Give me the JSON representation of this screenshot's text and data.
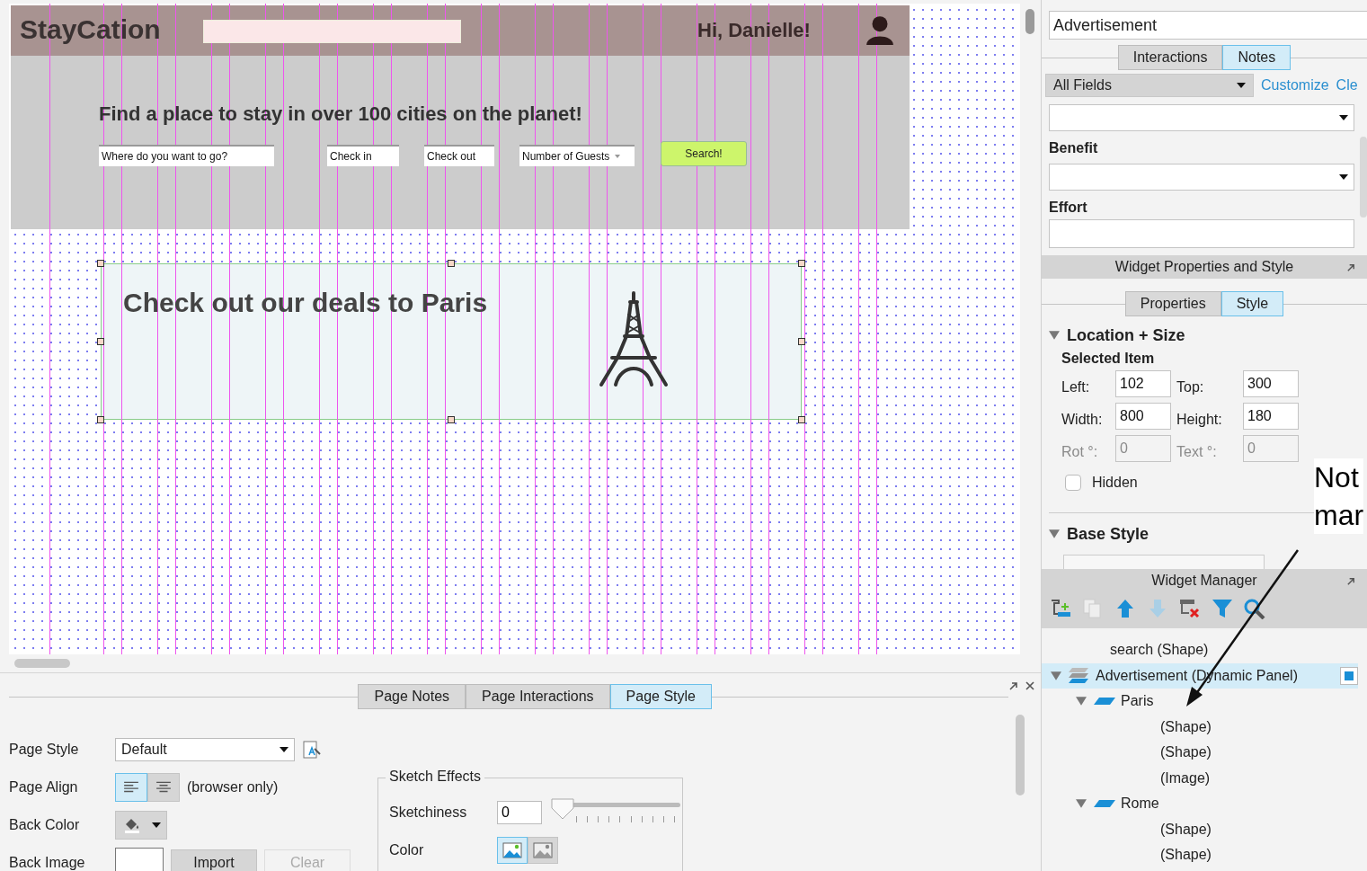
{
  "canvas": {
    "header": {
      "logo": "StayCation",
      "greeting": "Hi, Danielle!"
    },
    "hero": {
      "headline": "Find a place to stay in over 100 cities on the planet!",
      "fields": [
        {
          "kind": "text",
          "placeholder": "Where do you want to go?"
        },
        {
          "kind": "text",
          "placeholder": "Check in"
        },
        {
          "kind": "text",
          "placeholder": "Check out"
        },
        {
          "kind": "select",
          "placeholder": "Number of Guests"
        }
      ],
      "button": "Search!"
    },
    "ad_panel": {
      "text": "Check out our deals to Paris",
      "selected": true
    }
  },
  "page_tabs": [
    {
      "label": "Page Notes",
      "selected": false
    },
    {
      "label": "Page Interactions",
      "selected": false
    },
    {
      "label": "Page Style",
      "selected": true
    }
  ],
  "page_style": {
    "style_label": "Page Style",
    "style_value": "Default",
    "align_label": "Page Align",
    "align_options": [
      {
        "kind": "left",
        "selected": true
      },
      {
        "kind": "center",
        "selected": false
      }
    ],
    "align_note": "(browser only)",
    "back_color_label": "Back Color",
    "back_image_label": "Back Image",
    "import_button": "Import",
    "clear_button": {
      "label": "Clear",
      "disabled": true
    },
    "sketch": {
      "title": "Sketch Effects",
      "sketchiness_label": "Sketchiness",
      "sketchiness_value": "0",
      "level": 0,
      "color_label": "Color",
      "color_modes": [
        {
          "kind": "color",
          "selected": true
        },
        {
          "kind": "grayscale",
          "selected": false
        }
      ]
    }
  },
  "notes_panel": {
    "name_value": "Advertisement",
    "tabs": [
      {
        "label": "Interactions",
        "selected": false
      },
      {
        "label": "Notes",
        "selected": true
      }
    ],
    "filter": "All Fields",
    "links": [
      "Customize",
      "Cle"
    ],
    "fields": [
      {
        "kind": "select"
      },
      {
        "kind": "select",
        "label": "Benefit"
      },
      {
        "kind": "text",
        "label": "Effort"
      }
    ]
  },
  "properties_panel": {
    "title": "Widget Properties and Style",
    "tabs": [
      {
        "label": "Properties",
        "selected": false
      },
      {
        "label": "Style",
        "selected": true
      }
    ],
    "location": {
      "title": "Location + Size",
      "expanded": true,
      "subtitle": "Selected Item",
      "fields": [
        {
          "label": "Left:",
          "value": "102",
          "disabled": false
        },
        {
          "label": "Top:",
          "value": "300",
          "disabled": false
        },
        {
          "label": "Width:",
          "value": "800",
          "disabled": false
        },
        {
          "label": "Height:",
          "value": "180",
          "disabled": false
        },
        {
          "label": "Rot °:",
          "value": "0",
          "disabled": true
        },
        {
          "label": "Text °:",
          "value": "0",
          "disabled": true
        }
      ],
      "hidden": {
        "label": "Hidden",
        "checked": false
      }
    },
    "base_style": {
      "title": "Base Style",
      "expanded": true
    }
  },
  "widget_manager": {
    "title": "Widget Manager",
    "tree": [
      {
        "label": "search (Shape)",
        "kind": "shape",
        "selected": false
      },
      {
        "label": "Advertisement (Dynamic Panel)",
        "kind": "panel",
        "selected": true,
        "expanded": true,
        "children": [
          {
            "label": "Paris",
            "kind": "state",
            "selected": false,
            "expanded": true,
            "children": [
              {
                "label": "(Shape)",
                "kind": "shape",
                "selected": false
              },
              {
                "label": "(Shape)",
                "kind": "shape",
                "selected": false
              },
              {
                "label": "(Image)",
                "kind": "shape",
                "selected": false
              }
            ]
          },
          {
            "label": "Rome",
            "kind": "state",
            "selected": false,
            "expanded": true,
            "children": [
              {
                "label": "(Shape)",
                "kind": "shape",
                "selected": false
              },
              {
                "label": "(Shape)",
                "kind": "shape",
                "selected": false
              }
            ]
          }
        ]
      }
    ]
  },
  "annotation": {
    "lines": [
      "Not",
      "mar"
    ]
  }
}
